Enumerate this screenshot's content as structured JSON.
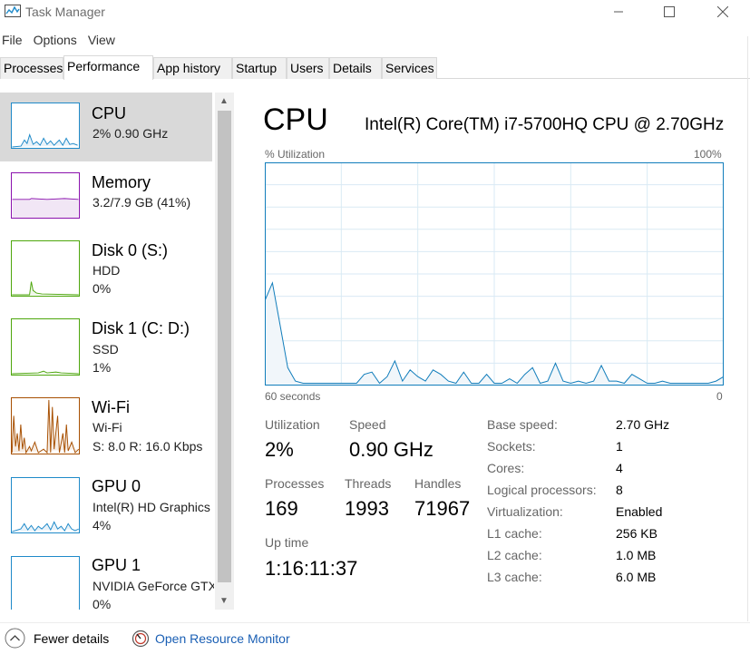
{
  "window": {
    "title": "Task Manager",
    "app_icon": "task-manager-icon"
  },
  "menu": [
    "File",
    "Options",
    "View"
  ],
  "tabs": [
    "Processes",
    "Performance",
    "App history",
    "Startup",
    "Users",
    "Details",
    "Services"
  ],
  "active_tab": "Performance",
  "sidebar": [
    {
      "title": "CPU",
      "sub1": "2%  0.90 GHz",
      "color": "#1f8ac9",
      "selected": true
    },
    {
      "title": "Memory",
      "sub1": "3.2/7.9 GB (41%)",
      "color": "#8b12ae"
    },
    {
      "title": "Disk 0 (S:)",
      "sub1": "HDD",
      "sub2": "0%",
      "color": "#4da60c"
    },
    {
      "title": "Disk 1 (C: D:)",
      "sub1": "SSD",
      "sub2": "1%",
      "color": "#4da60c"
    },
    {
      "title": "Wi-Fi",
      "sub1": "Wi-Fi",
      "sub2": "S: 8.0  R: 16.0 Kbps",
      "color": "#a74f01"
    },
    {
      "title": "GPU 0",
      "sub1": "Intel(R) HD Graphics",
      "sub2": "4%",
      "color": "#1f8ac9"
    },
    {
      "title": "GPU 1",
      "sub1": "NVIDIA GeForce GTX",
      "sub2": "0%",
      "color": "#1f8ac9"
    }
  ],
  "main": {
    "title": "CPU",
    "model": "Intel(R) Core(TM) i7-5700HQ CPU @ 2.70GHz",
    "graph_label": "% Utilization",
    "graph_max": "100%",
    "graph_time": "60 seconds",
    "graph_min": "0",
    "utilization_label": "Utilization",
    "utilization": "2%",
    "speed_label": "Speed",
    "speed": "0.90 GHz",
    "processes_label": "Processes",
    "processes": "169",
    "threads_label": "Threads",
    "threads": "1993",
    "handles_label": "Handles",
    "handles": "71967",
    "uptime_label": "Up time",
    "uptime": "1:16:11:37",
    "specs": [
      {
        "label": "Base speed:",
        "value": "2.70 GHz"
      },
      {
        "label": "Sockets:",
        "value": "1"
      },
      {
        "label": "Cores:",
        "value": "4"
      },
      {
        "label": "Logical processors:",
        "value": "8"
      },
      {
        "label": "Virtualization:",
        "value": "Enabled"
      },
      {
        "label": "L1 cache:",
        "value": "256 KB"
      },
      {
        "label": "L2 cache:",
        "value": "1.0 MB"
      },
      {
        "label": "L3 cache:",
        "value": "6.0 MB"
      }
    ]
  },
  "cpu_series": [
    38,
    46,
    27,
    8,
    2,
    1,
    1,
    1,
    1,
    1,
    1,
    1,
    1,
    5,
    6,
    1,
    4,
    11,
    2,
    7,
    4,
    2,
    7,
    5,
    2,
    1,
    6,
    1,
    1,
    5,
    1,
    1,
    3,
    1,
    5,
    8,
    1,
    2,
    10,
    2,
    1,
    2,
    1,
    2,
    9,
    2,
    2,
    1,
    5,
    3,
    1,
    1,
    2,
    1,
    1,
    1,
    1,
    1,
    1,
    2,
    4
  ],
  "cpu_series_max": 100,
  "footer": {
    "fewer_details": "Fewer details",
    "open_resource_monitor": "Open Resource Monitor"
  },
  "colors": {
    "cpu_line": "#117dbb",
    "cpu_fill": "#f1f6fa",
    "grid": "#d9eaf4"
  }
}
